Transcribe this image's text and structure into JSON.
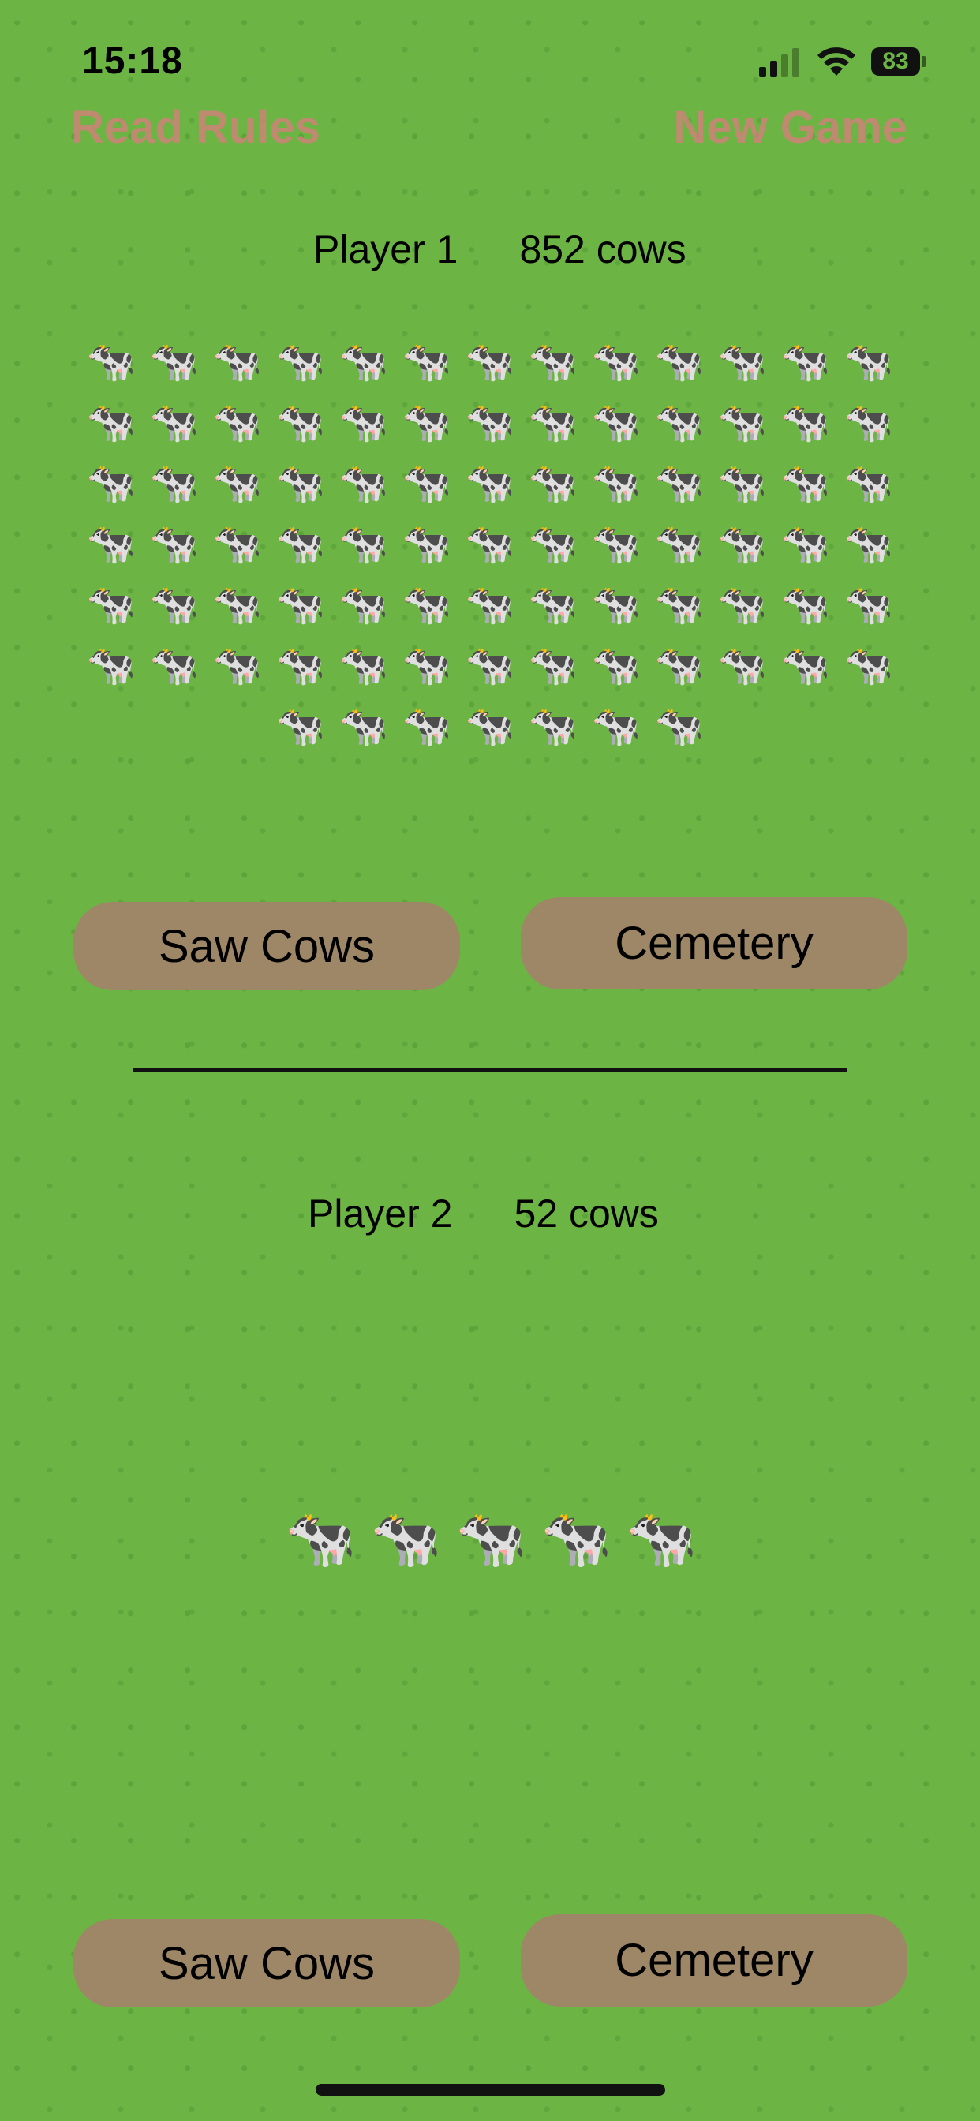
{
  "status_bar": {
    "time": "15:18",
    "battery": "83",
    "signal_icon": "cellular-signal-icon",
    "wifi_icon": "wifi-icon"
  },
  "nav": {
    "read_rules": "Read Rules",
    "new_game": "New Game"
  },
  "player1": {
    "name": "Player 1",
    "count": "852 cows",
    "herd_rows": [
      [
        "🐄",
        "🐄",
        "🐄",
        "🐄",
        "🐄",
        "🐄",
        "🐄",
        "🐄",
        "🐄",
        "🐄",
        "🐄",
        "🐄",
        "🐄"
      ],
      [
        "🐄",
        "🐄",
        "🐄",
        "🐄",
        "🐄",
        "🐄",
        "🐄",
        "🐄",
        "🐄",
        "🐄",
        "🐄",
        "🐄",
        "🐄"
      ],
      [
        "🐄",
        "🐄",
        "🐄",
        "🐄",
        "🐄",
        "🐄",
        "🐄",
        "🐄",
        "🐄",
        "🐄",
        "🐄",
        "🐄",
        "🐄"
      ],
      [
        "🐄",
        "🐄",
        "🐄",
        "🐄",
        "🐄",
        "🐄",
        "🐄",
        "🐄",
        "🐄",
        "🐄",
        "🐄",
        "🐄",
        "🐄"
      ],
      [
        "🐄",
        "🐄",
        "🐄",
        "🐄",
        "🐄",
        "🐄",
        "🐄",
        "🐄",
        "🐄",
        "🐄",
        "🐄",
        "🐄",
        "🐄"
      ],
      [
        "🐄",
        "🐄",
        "🐄",
        "🐄",
        "🐄",
        "🐄",
        "🐄",
        "🐄",
        "🐄",
        "🐄",
        "🐄",
        "🐄",
        "🐄"
      ],
      [
        "🐄",
        "🐄",
        "🐄",
        "🐄",
        "🐄",
        "🐄",
        "🐄"
      ]
    ],
    "saw_cows": "Saw Cows",
    "cemetery": "Cemetery"
  },
  "player2": {
    "name": "Player 2",
    "count": "52 cows",
    "herd_rows": [
      [
        "🐄",
        "🐄",
        "🐄",
        "🐄",
        "🐄"
      ]
    ],
    "saw_cows": "Saw Cows",
    "cemetery": "Cemetery"
  },
  "colors": {
    "background": "#6cb444",
    "button": "#9e8766",
    "nav_link": "#cd8278"
  }
}
